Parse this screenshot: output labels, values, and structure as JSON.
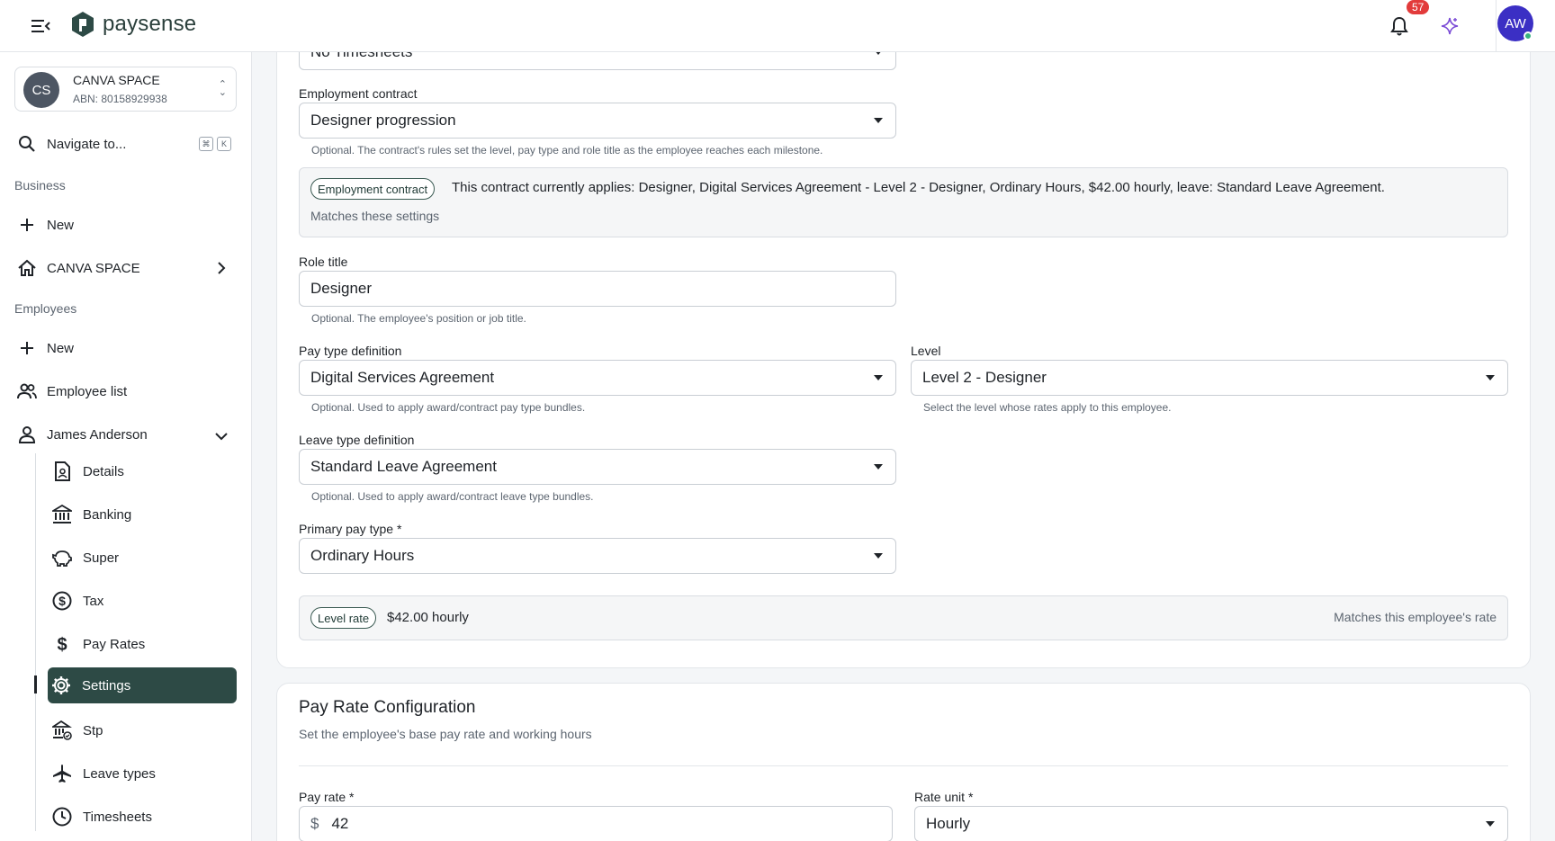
{
  "topbar": {
    "logo_text": "paysense",
    "notification_count": "57",
    "user_initials": "AW"
  },
  "sidebar": {
    "org": {
      "initials": "CS",
      "name": "CANVA SPACE",
      "abn": "ABN: 80158929938"
    },
    "navigate_label": "Navigate to...",
    "shortcut_keys": [
      "⌘",
      "K"
    ],
    "business_section": "Business",
    "business_new": "New",
    "business_org": "CANVA SPACE",
    "employees_section": "Employees",
    "employees_new": "New",
    "employee_list": "Employee list",
    "employee_name": "James Anderson",
    "sub_items": [
      {
        "label": "Details",
        "icon": "document-person-icon"
      },
      {
        "label": "Banking",
        "icon": "bank-icon"
      },
      {
        "label": "Super",
        "icon": "piggy-bank-icon"
      },
      {
        "label": "Tax",
        "icon": "dollar-circle-icon"
      },
      {
        "label": "Pay Rates",
        "icon": "dollar-icon"
      },
      {
        "label": "Settings",
        "icon": "gear-icon",
        "active": true
      },
      {
        "label": "Stp",
        "icon": "bank-check-icon"
      },
      {
        "label": "Leave types",
        "icon": "airplane-icon"
      },
      {
        "label": "Timesheets",
        "icon": "clock-icon"
      }
    ]
  },
  "main": {
    "timesheet_value": "No Timesheets",
    "employment_contract": {
      "label": "Employment contract",
      "value": "Designer progression",
      "helper": "Optional. The contract's rules set the level, pay type and role title as the employee reaches each milestone."
    },
    "contract_info": {
      "chip": "Employment contract",
      "text": "This contract currently applies: Designer, Digital Services Agreement - Level 2 - Designer, Ordinary Hours, $42.00 hourly, leave: Standard Leave Agreement.",
      "sub": "Matches these settings"
    },
    "role_title": {
      "label": "Role title",
      "value": "Designer",
      "helper": "Optional. The employee's position or job title."
    },
    "pay_type_definition": {
      "label": "Pay type definition",
      "value": "Digital Services Agreement",
      "helper": "Optional. Used to apply award/contract pay type bundles."
    },
    "level": {
      "label": "Level",
      "value": "Level 2 - Designer",
      "helper": "Select the level whose rates apply to this employee."
    },
    "leave_type_definition": {
      "label": "Leave type definition",
      "value": "Standard Leave Agreement",
      "helper": "Optional. Used to apply award/contract leave type bundles."
    },
    "primary_pay_type": {
      "label": "Primary pay type",
      "required": "*",
      "value": "Ordinary Hours"
    },
    "level_rate": {
      "chip": "Level rate",
      "value": "$42.00 hourly",
      "status": "Matches this employee's rate"
    },
    "pay_rate_config": {
      "title": "Pay Rate Configuration",
      "description": "Set the employee's base pay rate and working hours",
      "pay_rate_label": "Pay rate",
      "pay_rate_required": "*",
      "currency": "$",
      "pay_rate_value": "42",
      "rate_unit_label": "Rate unit",
      "rate_unit_required": "*",
      "rate_unit_value": "Hourly"
    }
  }
}
